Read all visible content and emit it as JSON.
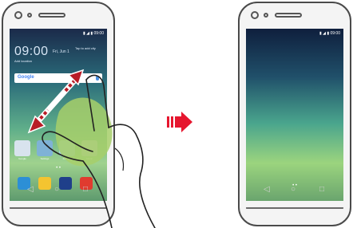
{
  "left_phone": {
    "status_time": "09:00",
    "clock": "09:00",
    "date": "Fri, Jun 1",
    "hint_line1": "Tap to add city",
    "hint_line2": "",
    "weather": "Add location",
    "search_logo": "Google",
    "app_labels": [
      "Google",
      "Settings",
      "Camera",
      "Music"
    ],
    "dots": "• •",
    "nav": [
      "◁",
      "○",
      "□"
    ]
  },
  "right_phone": {
    "status_time": "09:00",
    "dots": "• •",
    "nav": [
      "◁",
      "○",
      "□"
    ]
  },
  "colors": {
    "arrow_red": "#e6172f",
    "gesture_arrow": "#b81c26",
    "hand_highlight": "#a7cf6a"
  },
  "icons": {
    "transition": "right-arrow-icon",
    "gesture": "diagonal-double-arrow-icon"
  }
}
